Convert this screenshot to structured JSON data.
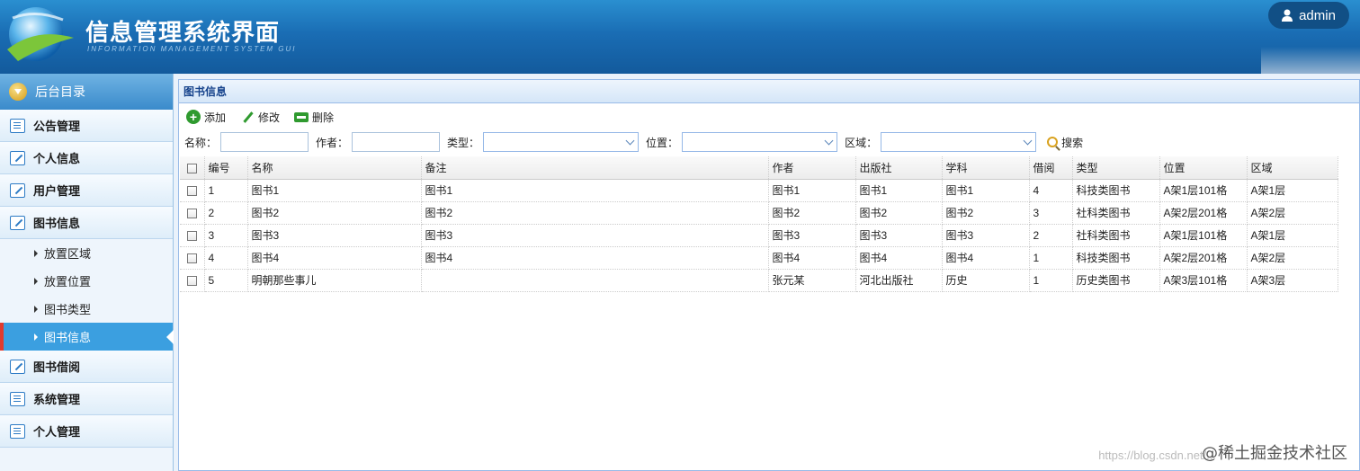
{
  "header": {
    "title": "信息管理系统界面",
    "subtitle": "INFORMATION MANAGEMENT SYSTEM GUI",
    "user": "admin"
  },
  "sidebar": {
    "heading": "后台目录",
    "items": [
      {
        "label": "公告管理",
        "icon": "list-icon"
      },
      {
        "label": "个人信息",
        "icon": "edit-icon"
      },
      {
        "label": "用户管理",
        "icon": "edit-icon"
      },
      {
        "label": "图书信息",
        "icon": "edit-icon"
      }
    ],
    "sub_items": [
      "放置区域",
      "放置位置",
      "图书类型",
      "图书信息"
    ],
    "items_after": [
      {
        "label": "图书借阅",
        "icon": "edit-icon"
      },
      {
        "label": "系统管理",
        "icon": "list-icon"
      },
      {
        "label": "个人管理",
        "icon": "list-icon"
      }
    ]
  },
  "panel": {
    "title": "图书信息",
    "toolbar": {
      "add": "添加",
      "edit": "修改",
      "delete": "删除"
    },
    "filters": {
      "name_label": "名称：",
      "author_label": "作者：",
      "type_label": "类型：",
      "position_label": "位置：",
      "area_label": "区域：",
      "search": "搜索"
    },
    "table": {
      "columns": [
        "编号",
        "名称",
        "备注",
        "作者",
        "出版社",
        "学科",
        "借阅",
        "类型",
        "位置",
        "区域"
      ],
      "rows": [
        [
          "1",
          "图书1",
          "图书1",
          "图书1",
          "图书1",
          "图书1",
          "4",
          "科技类图书",
          "A架1层101格",
          "A架1层"
        ],
        [
          "2",
          "图书2",
          "图书2",
          "图书2",
          "图书2",
          "图书2",
          "3",
          "社科类图书",
          "A架2层201格",
          "A架2层"
        ],
        [
          "3",
          "图书3",
          "图书3",
          "图书3",
          "图书3",
          "图书3",
          "2",
          "社科类图书",
          "A架1层101格",
          "A架1层"
        ],
        [
          "4",
          "图书4",
          "图书4",
          "图书4",
          "图书4",
          "图书4",
          "1",
          "科技类图书",
          "A架2层201格",
          "A架2层"
        ],
        [
          "5",
          "明朝那些事儿",
          "",
          "张元某",
          "河北出版社",
          "历史",
          "1",
          "历史类图书",
          "A架3层101格",
          "A架3层"
        ]
      ]
    }
  },
  "watermark": {
    "text": "@稀土掘金技术社区",
    "url": "https://blog.csdn.net/..."
  }
}
